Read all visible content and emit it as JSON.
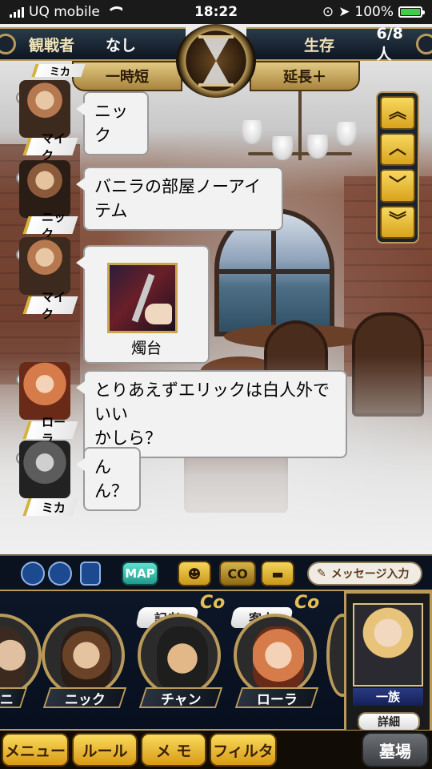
{
  "status_bar": {
    "carrier": "UQ mobile",
    "time": "18:22",
    "battery": "100%"
  },
  "hud": {
    "spectator_label": "観戦者",
    "spectator_value": "なし",
    "alive_label": "生存",
    "alive_value": "6/8人",
    "shorten_label": "一時短",
    "extend_label": "延長＋"
  },
  "scroll": {
    "top": "︽",
    "up": "︿",
    "down": "﹀",
    "bottom": "︾"
  },
  "chat": [
    {
      "name": "ミカ",
      "text": ""
    },
    {
      "name": "マイク",
      "text": "ニック"
    },
    {
      "name": "ニック",
      "text": "バニラの部屋ノーアイテム"
    },
    {
      "name": "マイク",
      "text": "",
      "item": "燭台"
    },
    {
      "name": "ローラ",
      "text": "とりあえずエリックは白人外でいい\nかしら？"
    },
    {
      "name": "ミカ",
      "text": "んん？"
    }
  ],
  "controls": {
    "map": "MAP",
    "co": "CO",
    "message_input": "メッセージ入力"
  },
  "players": [
    {
      "name": "ニ",
      "tag": ""
    },
    {
      "name": "ニック",
      "tag": ""
    },
    {
      "name": "チャン",
      "tag": "記者",
      "co": "Co"
    },
    {
      "name": "ローラ",
      "tag": "客人",
      "co": "Co"
    }
  ],
  "self_card": {
    "role": "一族",
    "detail": "詳細"
  },
  "menu": {
    "menu": "メニュー",
    "rules": "ルール",
    "memo": "メ モ",
    "filter": "フィルタ",
    "grave": "墓場"
  },
  "colors": {
    "accent_gold": "#b99a5a",
    "button_yellow": "#f4d45a",
    "hud_dark": "#0d1621"
  }
}
